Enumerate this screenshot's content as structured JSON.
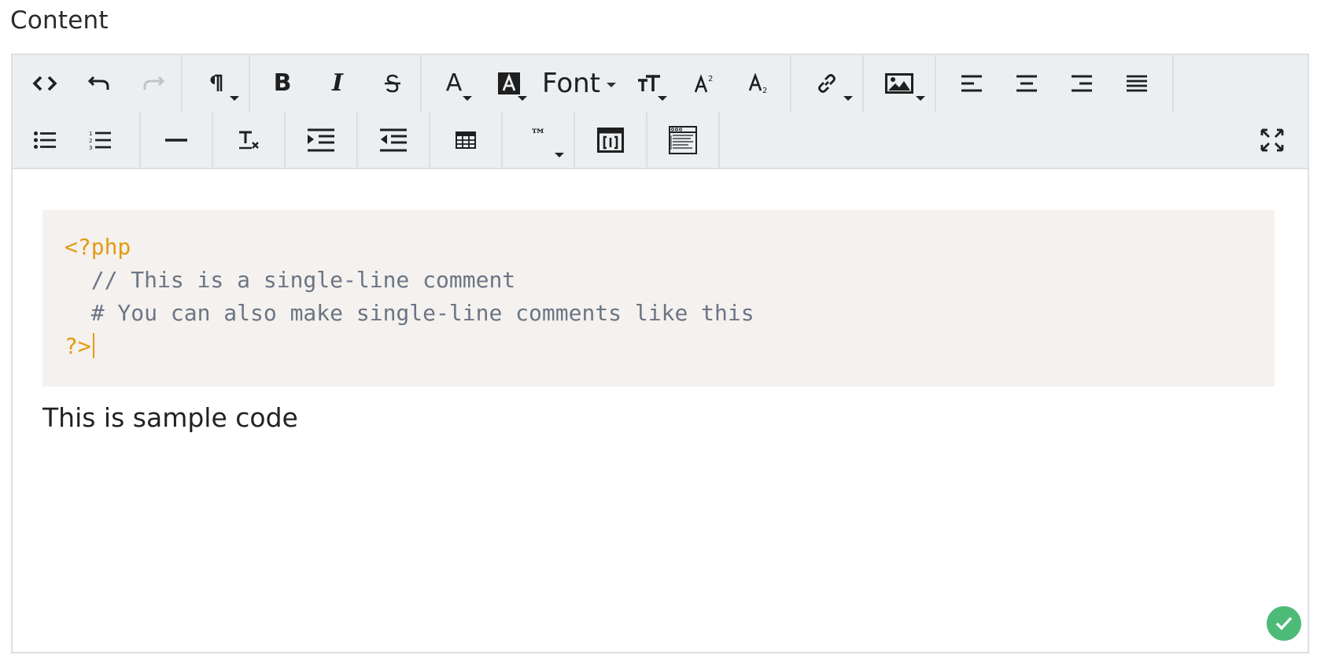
{
  "field": {
    "label": "Content"
  },
  "toolbar": {
    "font_label": "Font",
    "row1_icons": [
      "code-view-icon",
      "undo-icon",
      "redo-icon",
      "paragraph-format-icon",
      "bold-icon",
      "italic-icon",
      "strikethrough-icon",
      "text-color-icon",
      "background-color-icon",
      "font-size-icon",
      "superscript-icon",
      "subscript-icon",
      "insert-link-icon",
      "insert-image-icon",
      "align-left-icon",
      "align-center-icon",
      "align-right-icon",
      "align-justify-icon"
    ],
    "row2_icons": [
      "unordered-list-icon",
      "ordered-list-icon",
      "horizontal-line-icon",
      "clear-formatting-icon",
      "indent-icon",
      "outdent-icon",
      "insert-table-icon",
      "special-characters-icon",
      "insert-shortcode-icon",
      "insert-template-icon",
      "fullscreen-icon"
    ],
    "special_chars_glyph": "™"
  },
  "editor": {
    "code": {
      "open_tag": "<?php",
      "line1": "  // This is a single-line comment",
      "line2": "  # You can also make single-line comments like this",
      "close_tag": "?>"
    },
    "paragraph": "This is sample code"
  },
  "colors": {
    "code_tag": "#e49a13",
    "code_comment": "#6b7585",
    "code_background": "#f4f1ee",
    "toolbar_background": "#ebeff1",
    "status_ok": "#4cbb78"
  }
}
